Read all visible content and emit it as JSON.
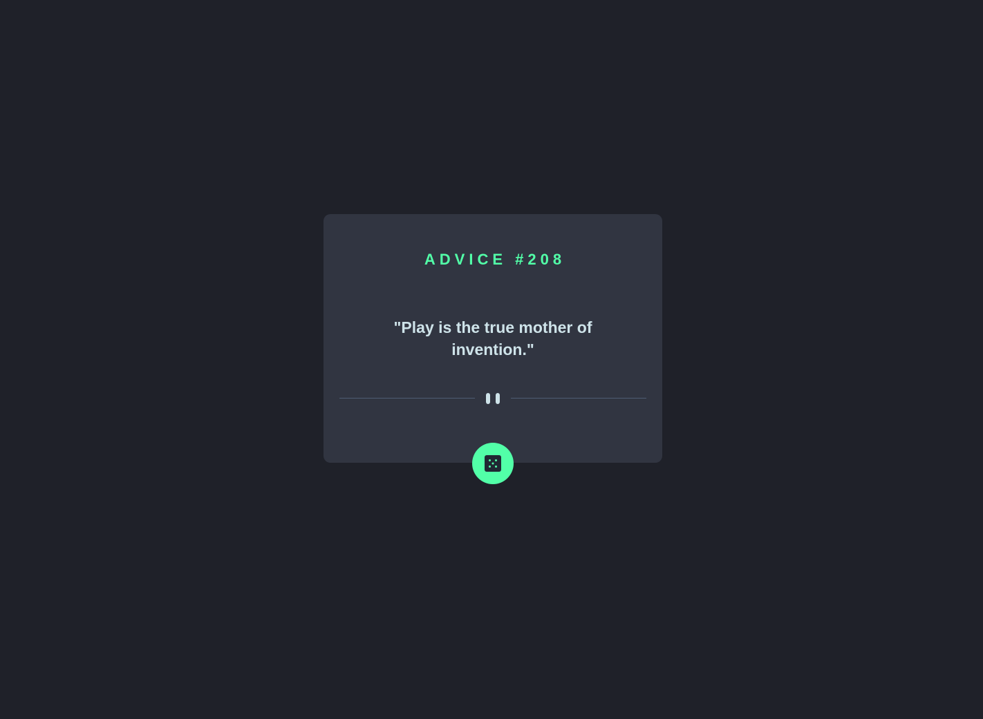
{
  "advice": {
    "id_label": "ADVICE #208",
    "text": "\"Play is the true mother of invention.\""
  },
  "divider": {
    "icon": "pause-icon"
  },
  "generate_button": {
    "icon": "dice-icon"
  },
  "colors": {
    "background": "#1f2129",
    "card": "#313541",
    "accent": "#52ffa8",
    "text": "#cee3e9",
    "divider": "#4f5d74"
  }
}
